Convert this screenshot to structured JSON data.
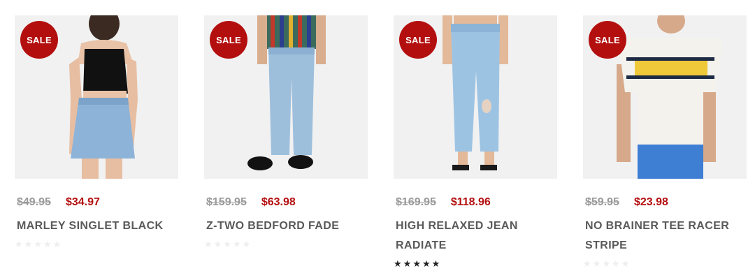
{
  "products": [
    {
      "badge": "SALE",
      "old_price": "$49.95",
      "new_price": "$34.97",
      "title": "MARLEY SINGLET BLACK",
      "rating": 0,
      "image_icon": "model-singlet-skirt"
    },
    {
      "badge": "SALE",
      "old_price": "$159.95",
      "new_price": "$63.98",
      "title": "Z-TWO BEDFORD FADE",
      "rating": 0,
      "image_icon": "model-jeans-men"
    },
    {
      "badge": "SALE",
      "old_price": "$169.95",
      "new_price": "$118.96",
      "title": "HIGH RELAXED JEAN RADIATE",
      "rating": 5,
      "image_icon": "model-jeans-women"
    },
    {
      "badge": "SALE",
      "old_price": "$59.95",
      "new_price": "$23.98",
      "title": "NO BRAINER TEE RACER STRIPE",
      "rating": 0,
      "image_icon": "model-striped-tee"
    }
  ],
  "colors": {
    "sale": "#b40f0f",
    "old_price": "#9a9a9a",
    "title": "#5a5a5a",
    "star_empty": "#eeeeee",
    "star_filled": "#222222",
    "image_bg": "#f1f1f1"
  }
}
